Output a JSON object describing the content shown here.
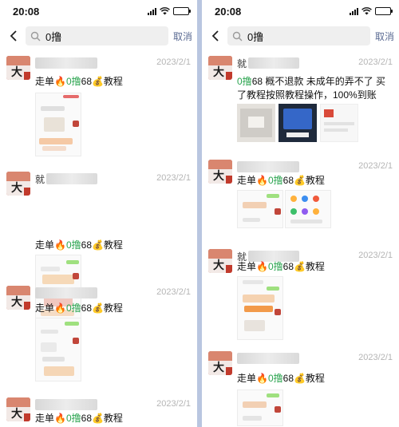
{
  "status": {
    "time": "20:08"
  },
  "search": {
    "query": "0撸",
    "cancel_label": "取消"
  },
  "left_panel": {
    "posts": [
      {
        "date": "2023/2/1",
        "text_pre": "走单🔥",
        "text_hl": "0撸",
        "text_post": "68💰教程"
      },
      {
        "name_initial": "就",
        "date": "2023/2/1",
        "text_pre": "走单🔥",
        "text_hl": "0撸",
        "text_post": "68💰教程"
      },
      {
        "date": "2023/2/1",
        "text_pre": "走单🔥",
        "text_hl": "0撸",
        "text_post": "68💰教程"
      },
      {
        "date": "2023/2/1",
        "text_pre": "走单🔥",
        "text_hl": "0撸",
        "text_post": "68💰教程"
      }
    ]
  },
  "right_panel": {
    "posts": [
      {
        "name_initial": "就",
        "date": "2023/2/1",
        "text_hl": "0撸",
        "text_post": "68 概不退款 未成年的弄不了 买了教程按照教程操作，100%到账"
      },
      {
        "date": "2023/2/1",
        "text_pre": "走单🔥",
        "text_hl": "0撸",
        "text_post": "68💰教程"
      },
      {
        "name_initial": "就",
        "date": "2023/2/1",
        "text_pre": "走单🔥",
        "text_hl": "0撸",
        "text_post": "68💰教程"
      },
      {
        "date": "2023/2/1",
        "text_pre": "走单🔥",
        "text_hl": "0撸",
        "text_post": "68💰教程"
      }
    ]
  }
}
